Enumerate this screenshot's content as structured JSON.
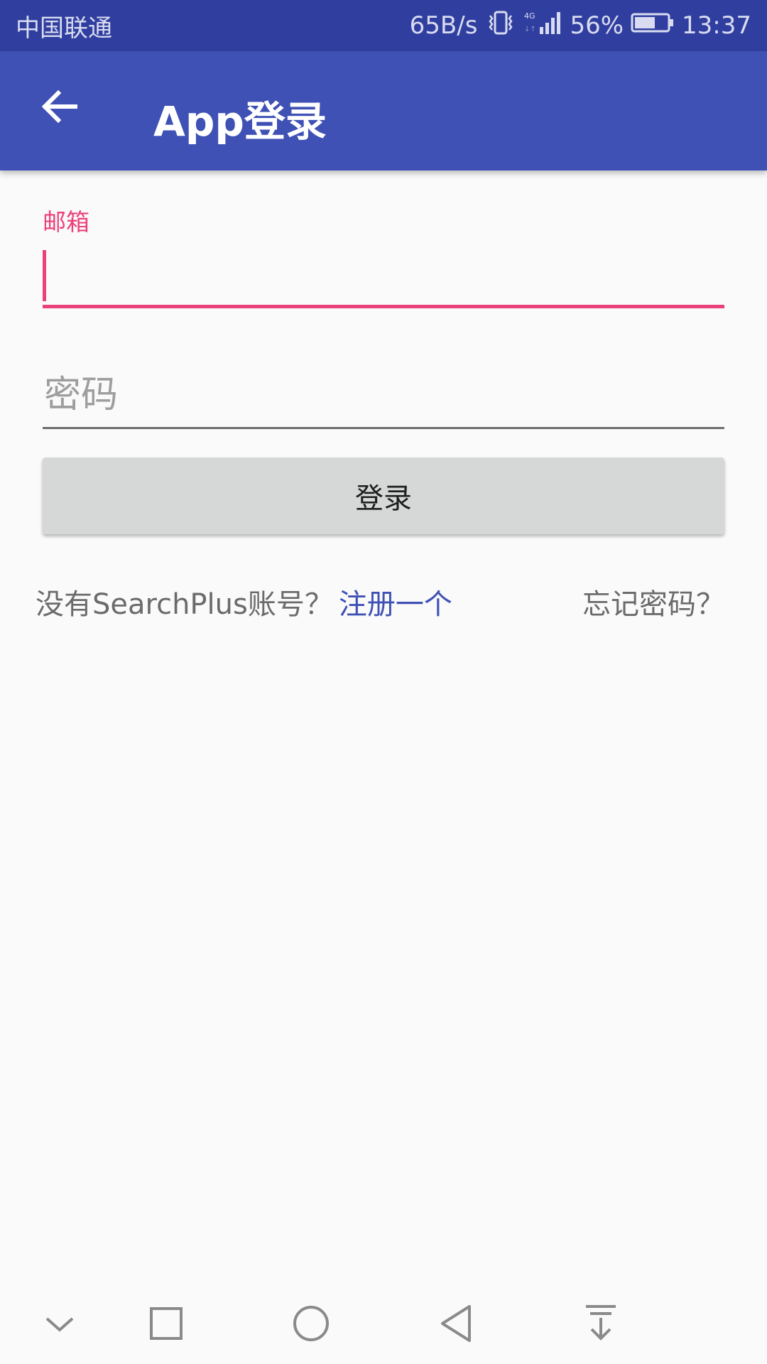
{
  "status_bar": {
    "carrier": "中国联通",
    "speed": "65B/s",
    "battery": "56%",
    "time": "13:37",
    "icons": [
      "vibrate-icon",
      "signal-4g-icon",
      "battery-icon"
    ]
  },
  "app_bar": {
    "back_icon": "arrow-left-icon",
    "title": "App登录"
  },
  "form": {
    "email": {
      "label": "邮箱",
      "value": ""
    },
    "password": {
      "placeholder": "密码",
      "value": ""
    },
    "login_button": "登录"
  },
  "links": {
    "no_account_text": "没有SearchPlus账号？",
    "register": "注册一个",
    "forgot_password": "忘记密码？"
  },
  "nav_bar": {
    "icons": [
      "chevron-down-icon",
      "recent-apps-icon",
      "home-icon",
      "back-icon",
      "notification-pull-icon"
    ]
  },
  "colors": {
    "status_bar": "#303f9f",
    "app_bar": "#3f51b5",
    "accent": "#ec407a",
    "link": "#3f51b5",
    "button": "#d6d7d7"
  }
}
